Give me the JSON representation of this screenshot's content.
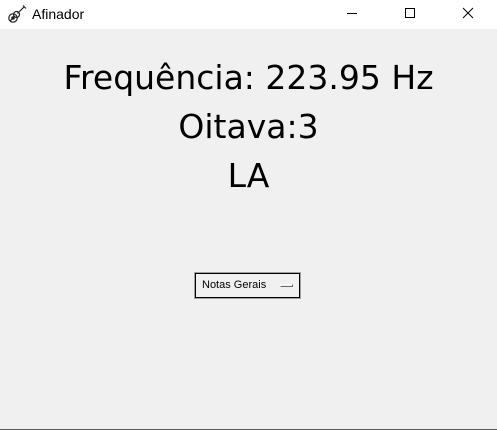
{
  "window": {
    "title": "Afinador",
    "icon": "guitar-icon",
    "controls": {
      "minimize": "minimize-icon",
      "maximize": "maximize-icon",
      "close": "close-icon"
    }
  },
  "tuner": {
    "frequency_text": "Frequência: 223.95 Hz",
    "octave_text": "Oitava:3",
    "note_text": "LA"
  },
  "menu": {
    "selected_label": "Notas Gerais"
  }
}
